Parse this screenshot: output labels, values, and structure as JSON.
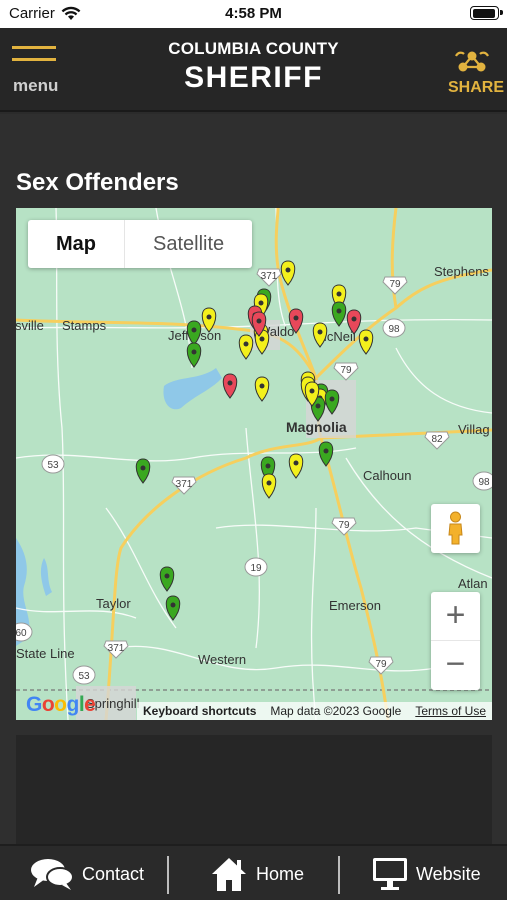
{
  "status_bar": {
    "carrier": "Carrier",
    "time": "4:58 PM"
  },
  "header": {
    "menu_label": "menu",
    "county": "COLUMBIA COUNTY",
    "agency": "SHERIFF",
    "share_label": "SHARE",
    "accent_color": "#e2b33f"
  },
  "page": {
    "title": "Sex Offenders"
  },
  "map": {
    "type_control": {
      "map": "Map",
      "satellite": "Satellite",
      "selected": "Map"
    },
    "places": [
      "Stephens",
      "Stamps",
      "sville",
      "Jefferson",
      "Waldo",
      "McNeil",
      "Magnolia",
      "Villag",
      "Calhoun",
      "Taylor",
      "State Line",
      "Western",
      "Emerson",
      "Atlan",
      "Springhill"
    ],
    "route_shields": [
      "371",
      "79",
      "98",
      "82",
      "53",
      "19",
      "98",
      "60",
      "371",
      "53",
      "79"
    ],
    "attribution": {
      "logo": "Google",
      "keyboard": "Keyboard shortcuts",
      "data": "Map data ©2023 Google",
      "terms": "Terms of Use"
    },
    "zoom_in": "+",
    "zoom_out": "−",
    "marker_colors": {
      "green": "#3aa820",
      "yellow": "#f3f01c",
      "red": "#e8485a"
    },
    "marker_count": 40
  },
  "tabs": [
    {
      "label": "Contact",
      "icon": "chat-bubbles-icon"
    },
    {
      "label": "Home",
      "icon": "house-icon"
    },
    {
      "label": "Website",
      "icon": "monitor-icon"
    }
  ]
}
